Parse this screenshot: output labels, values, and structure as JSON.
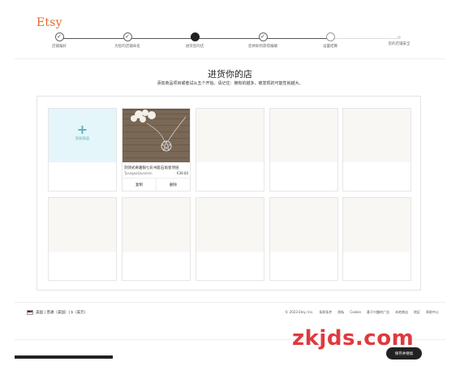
{
  "brand": {
    "logo": "Etsy"
  },
  "progress": {
    "steps": [
      {
        "label": "店铺偏好",
        "state": "done",
        "icon": "check-icon"
      },
      {
        "label": "为您的店铺命名",
        "state": "done",
        "icon": "check-icon"
      },
      {
        "label": "进货您的店",
        "state": "current",
        "icon": "current-dot-icon"
      },
      {
        "label": "您将如何获得报酬",
        "state": "done",
        "icon": "check-icon"
      },
      {
        "label": "设置结算",
        "state": "future",
        "icon": "empty-circle-icon"
      },
      {
        "label": "您的店铺安全",
        "state": "disabled",
        "icon": "small-dot-icon"
      }
    ]
  },
  "header": {
    "title": "进货你的店",
    "subtitle": "添加商品项目或者试从五个开始。请记住：拥有的越多，被发现的可能性就越大。"
  },
  "grid": {
    "add_label": "添加商品",
    "listing": {
      "title": "刻领式奇趣银七彩书匙石角星项链",
      "shop": "TyangeaQuanlein",
      "price": "€39.00",
      "copy_label": "复制",
      "delete_label": "删除"
    }
  },
  "footer": {
    "locale": "美国 | 普通（美国）| $（美元）",
    "links": [
      "© 2023 Etsy, Inc.",
      "条款条件",
      "隐私",
      "Cookie",
      "基于兴趣的广告",
      "本地商店",
      "地区",
      "帮助中心"
    ]
  },
  "actions": {
    "next_label": "保存并继续"
  },
  "watermark": "zkjds.com",
  "colors": {
    "accent": "#e06a2c",
    "add_tint": "#e5f6fa",
    "add_icon": "#5bb0bd"
  }
}
